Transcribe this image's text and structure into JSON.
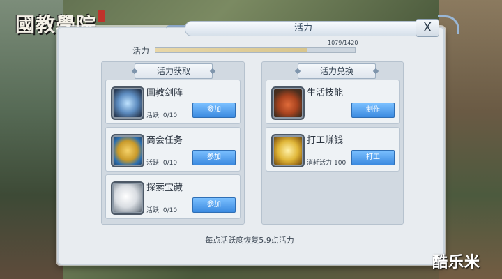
{
  "header": {
    "logo_text": "國教學院",
    "title": "活力",
    "close_label": "X"
  },
  "vitality": {
    "label": "活力",
    "value_text": "1079/1420",
    "progress": 0.76
  },
  "left_column": {
    "heading": "活力获取",
    "cards": [
      {
        "name": "国教剑阵",
        "sub": "活跃: 0/10",
        "button": "参加",
        "icon": "sword-array-icon"
      },
      {
        "name": "商会任务",
        "sub": "活跃: 0/10",
        "button": "参加",
        "icon": "guild-coin-icon"
      },
      {
        "name": "探索宝藏",
        "sub": "活跃: 0/10",
        "button": "参加",
        "icon": "treasure-pearl-icon"
      }
    ]
  },
  "right_column": {
    "heading": "活力兑换",
    "cards": [
      {
        "name": "生活技能",
        "sub": "",
        "button": "制作",
        "icon": "roast-food-icon"
      },
      {
        "name": "打工赚钱",
        "sub": "消耗活力:100",
        "button": "打工",
        "icon": "gold-coin-icon"
      }
    ]
  },
  "footer": {
    "text": "每点活跃度恢复5.9点活力"
  },
  "watermark": {
    "text": "酷乐米"
  }
}
